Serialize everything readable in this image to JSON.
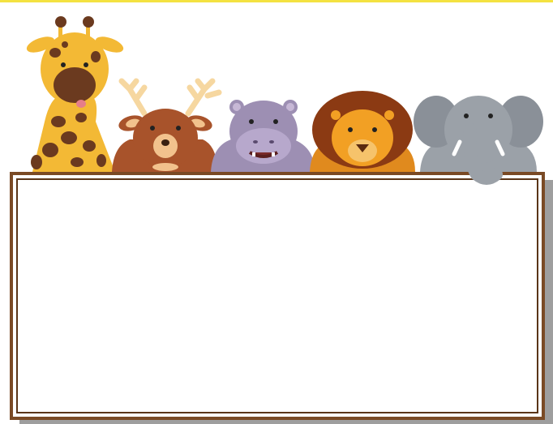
{
  "colors": {
    "accent_bar": "#f4e241",
    "board_frame": "#7a4a25",
    "board_frame_dark": "#5a3518",
    "board_fill": "#ffffff",
    "shadow": "#9e9e9e",
    "giraffe_body": "#f3b935",
    "giraffe_spots": "#6b3a1f",
    "deer_body": "#a8532b",
    "antler": "#f6d7a0",
    "hippo_body": "#9d8fb3",
    "lion_mane": "#8b3a13",
    "lion_face": "#f2a024",
    "elephant_body": "#9ba1a8"
  },
  "icons": [
    "giraffe-icon",
    "deer-icon",
    "hippo-icon",
    "lion-icon",
    "elephant-icon"
  ]
}
